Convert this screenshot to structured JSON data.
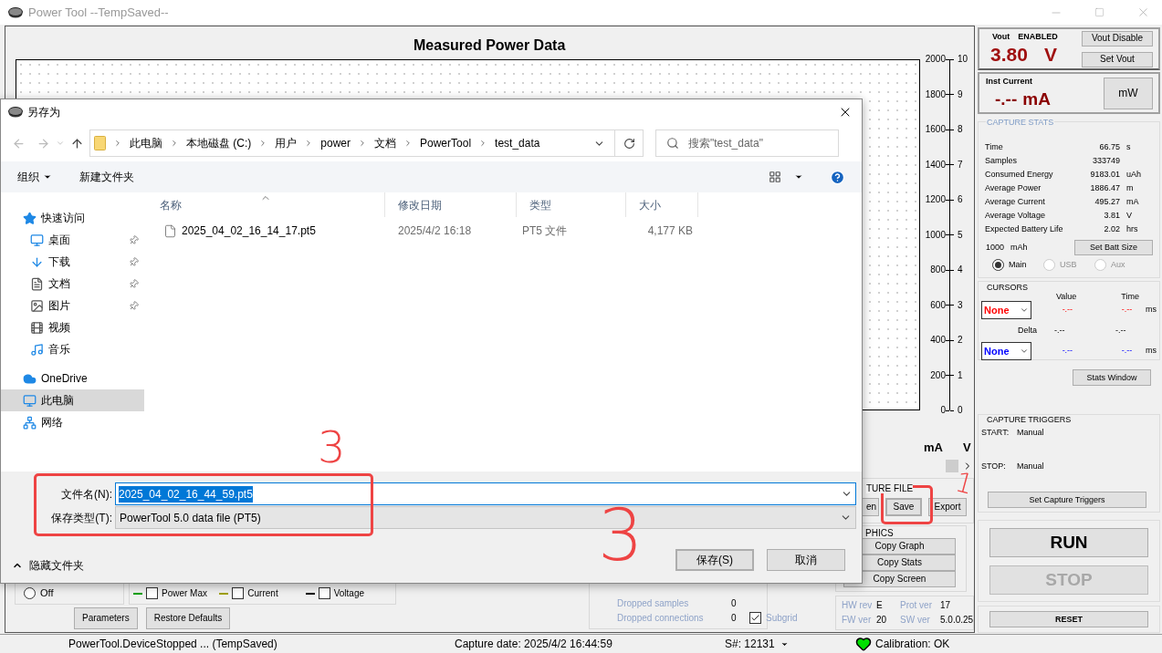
{
  "window": {
    "title": "Power Tool --TempSaved--"
  },
  "graph": {
    "title": "Measured Power Data",
    "ma_ticks": [
      "2000",
      "1800",
      "1600",
      "1400",
      "1200",
      "1000",
      "800",
      "600",
      "400",
      "200",
      "0"
    ],
    "v_ticks": [
      "10",
      "9",
      "8",
      "7",
      "6",
      "5",
      "4",
      "3",
      "2",
      "1",
      "0"
    ],
    "ma_unit": "mA",
    "v_unit": "V"
  },
  "bottom": {
    "display_off": {
      "label": "Off",
      "selected": false
    },
    "legend": [
      {
        "label": "Power Max",
        "checked": false,
        "color": "#00a000"
      },
      {
        "label": "Current",
        "checked": false,
        "color": "#a0a000"
      },
      {
        "label": "Voltage",
        "checked": false,
        "color": "#000000"
      }
    ],
    "buttons": [
      "Parameters",
      "Restore Defaults"
    ],
    "counters": [
      {
        "label": "Dropped samples",
        "value": "0"
      },
      {
        "label": "Dropped connections",
        "value": "0"
      }
    ],
    "subgrid": {
      "label": "Subgrid",
      "checked": true
    },
    "capture_file": {
      "title": "TURE FILE",
      "buttons": [
        {
          "label": "en",
          "focused": false
        },
        {
          "label": "Save",
          "focused": true
        },
        {
          "label": "Export",
          "focused": false
        }
      ]
    },
    "graphics": {
      "title": "PHICS",
      "buttons": [
        "Copy Graph",
        "Copy Stats",
        "Copy Screen"
      ]
    },
    "versions": [
      {
        "label": "HW rev",
        "value": "E"
      },
      {
        "label": "Prot ver",
        "value": "17"
      },
      {
        "label": "FW ver",
        "value": "20"
      },
      {
        "label": "SW ver",
        "value": "5.0.0.25"
      }
    ]
  },
  "side_panel": {
    "vout": {
      "label": "Vout",
      "state": "ENABLED",
      "reading": "3.80",
      "unit": "V",
      "buttons": [
        "Vout Disable",
        "Set Vout"
      ]
    },
    "current": {
      "label": "Inst Current",
      "reading": "-.--",
      "unit": "mA",
      "button": "mW"
    },
    "capture_stats": {
      "title": "CAPTURE STATS",
      "rows": [
        {
          "label": "Time",
          "value": "66.75",
          "unit": "s"
        },
        {
          "label": "Samples",
          "value": "333749",
          "unit": ""
        },
        {
          "label": "Consumed Energy",
          "value": "9183.01",
          "unit": "uAh"
        },
        {
          "label": "Average Power",
          "value": "1886.47",
          "unit": "m"
        },
        {
          "label": "Average Current",
          "value": "495.27",
          "unit": "mA"
        },
        {
          "label": "Average Voltage",
          "value": "3.81",
          "unit": "V"
        },
        {
          "label": "Expected Battery Life",
          "value": "2.02",
          "unit": "hrs"
        }
      ],
      "battery": {
        "value": "1000",
        "unit": "mAh",
        "button": "Set Batt Size"
      },
      "sources": [
        {
          "label": "Main",
          "selected": true,
          "disabled": false
        },
        {
          "label": "USB",
          "selected": false,
          "disabled": true
        },
        {
          "label": "Aux",
          "selected": false,
          "disabled": true
        }
      ]
    },
    "cursors": {
      "title": "CURSORS",
      "headers": [
        "Value",
        "Time"
      ],
      "rows": [
        {
          "select": "None",
          "color": "#ff0000",
          "value": "-.--",
          "time": "-.--",
          "unit": "ms"
        },
        {
          "select": "None",
          "color": "#0000ff",
          "value": "-.--",
          "time": "-.--",
          "unit": "ms"
        }
      ],
      "delta": {
        "label": "Delta",
        "value": "-.--",
        "time": "-.--"
      },
      "button": "Stats Window"
    },
    "triggers": {
      "title": "CAPTURE TRIGGERS",
      "rows": [
        {
          "label": "START:",
          "value": "Manual"
        },
        {
          "label": "STOP:",
          "value": "Manual"
        }
      ],
      "button": "Set Capture Triggers"
    },
    "actions": [
      {
        "label": "RUN",
        "kind": "large",
        "disabled": false
      },
      {
        "label": "STOP",
        "kind": "large",
        "disabled": true
      },
      {
        "label": "RESET",
        "kind": "small",
        "disabled": false
      }
    ]
  },
  "status_bar": {
    "message": "PowerTool.DeviceStopped ... (TempSaved)",
    "capture_date": "Capture date: 2025/4/2 16:44:59",
    "serial": "S#: 12131",
    "calibration": "Calibration: OK"
  },
  "dialog": {
    "title": "另存为",
    "path": [
      "此电脑",
      "本地磁盘 (C:)",
      "用户",
      "power",
      "文档",
      "PowerTool",
      "test_data"
    ],
    "search_placeholder": "搜索\"test_data\"",
    "toolbar": [
      "组织",
      "新建文件夹"
    ],
    "nav": [
      {
        "label": "快速访问",
        "kind": "star",
        "selected": false,
        "children": [
          {
            "label": "桌面",
            "kind": "desktop",
            "pinned": true,
            "selected": false
          },
          {
            "label": "下载",
            "kind": "downloads",
            "pinned": true,
            "selected": false
          },
          {
            "label": "文档",
            "kind": "documents",
            "pinned": true,
            "selected": false
          },
          {
            "label": "图片",
            "kind": "pictures",
            "pinned": true,
            "selected": false
          },
          {
            "label": "视频",
            "kind": "videos",
            "pinned": false,
            "selected": false
          },
          {
            "label": "音乐",
            "kind": "music",
            "pinned": false,
            "selected": false
          }
        ]
      },
      {
        "label": "OneDrive",
        "kind": "cloud",
        "selected": false
      },
      {
        "label": "此电脑",
        "kind": "computer",
        "selected": true
      },
      {
        "label": "网络",
        "kind": "network",
        "selected": false
      }
    ],
    "columns": [
      {
        "label": "名称",
        "sorted": true
      },
      {
        "label": "修改日期",
        "sorted": false
      },
      {
        "label": "类型",
        "sorted": false
      },
      {
        "label": "大小",
        "sorted": false
      }
    ],
    "files": [
      {
        "name": "2025_04_02_16_14_17.pt5",
        "date": "2025/4/2 16:18",
        "type": "PT5 文件",
        "size": "4,177 KB",
        "selected": false
      }
    ],
    "filename_label": "文件名(N):",
    "filename": "2025_04_02_16_44_59.pt5",
    "filename_selected": true,
    "type_label": "保存类型(T):",
    "file_type": "PowerTool 5.0 data file (PT5)",
    "hide_folders": "隐藏文件夹",
    "buttons": [
      {
        "label": "保存(S)",
        "default": true
      },
      {
        "label": "取消",
        "default": false
      }
    ]
  },
  "annotations": [
    "3",
    "1",
    "3"
  ]
}
